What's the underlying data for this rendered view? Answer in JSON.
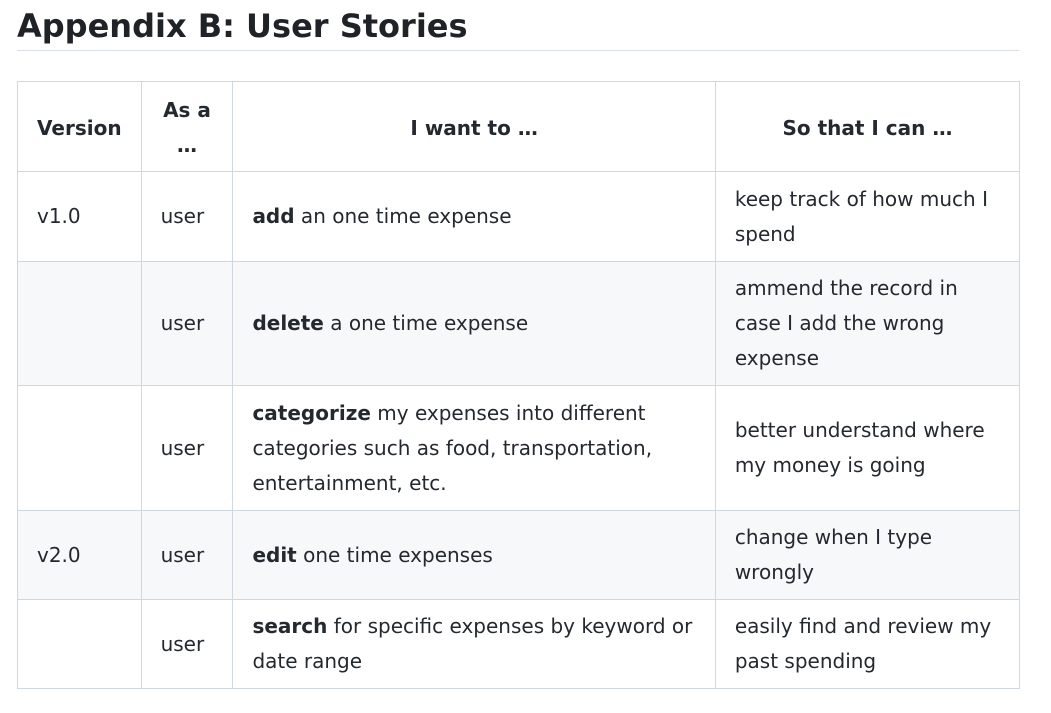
{
  "heading": "Appendix B: User Stories",
  "table": {
    "headers": [
      "Version",
      "As a …",
      "I want to …",
      "So that I can …"
    ],
    "rows": [
      {
        "version": "v1.0",
        "role": "user",
        "want_bold": "add",
        "want_rest": " an one time expense",
        "so_that": "keep track of how much I spend"
      },
      {
        "version": "",
        "role": "user",
        "want_bold": "delete",
        "want_rest": " a one time expense",
        "so_that": "ammend the record in case I add the wrong expense"
      },
      {
        "version": "",
        "role": "user",
        "want_bold": "categorize",
        "want_rest": " my expenses into different categories such as food, transportation, entertainment, etc.",
        "so_that": "better understand where my money is going"
      },
      {
        "version": "v2.0",
        "role": "user",
        "want_bold": "edit",
        "want_rest": " one time expenses",
        "so_that": "change when I type wrongly"
      },
      {
        "version": "",
        "role": "user",
        "want_bold": "search",
        "want_rest": " for specific expenses by keyword or date range",
        "so_that": "easily find and review my past spending"
      }
    ]
  }
}
